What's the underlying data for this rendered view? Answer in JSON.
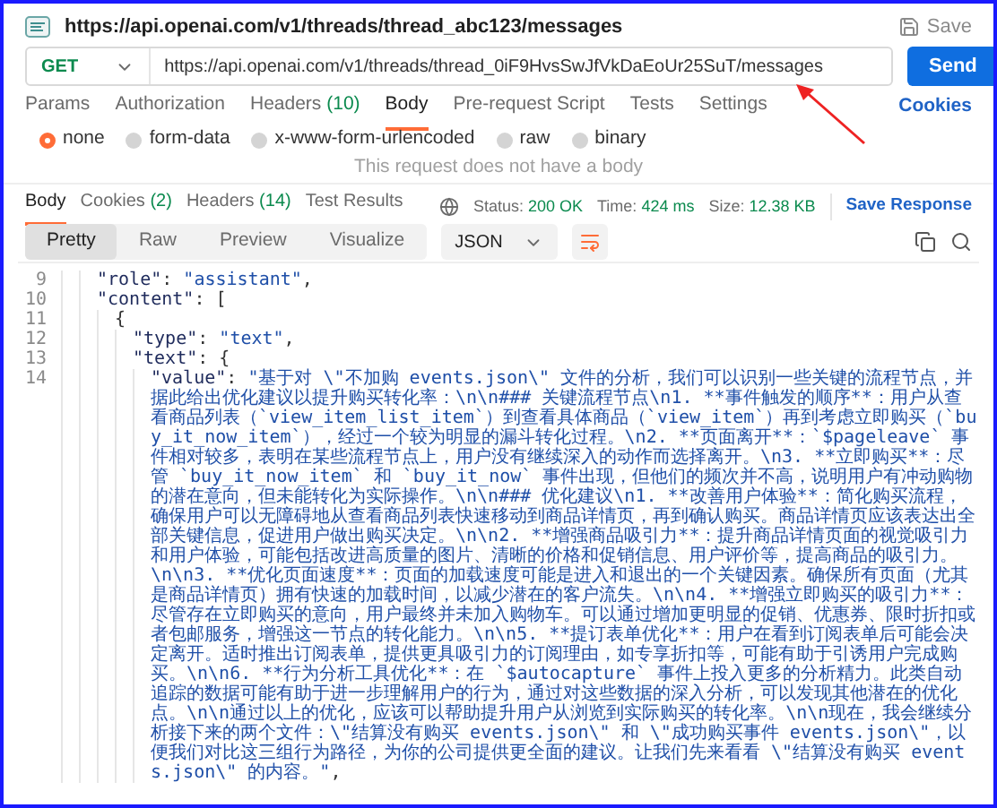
{
  "request": {
    "title": "https://api.openai.com/v1/threads/thread_abc123/messages",
    "save_label": "Save",
    "method": "GET",
    "url": "https://api.openai.com/v1/threads/thread_0iF9HvsSwJfVkDaEoUr25SuT/messages",
    "send_label": "Send"
  },
  "request_tabs": [
    {
      "label": "Params",
      "selected": false
    },
    {
      "label": "Authorization",
      "selected": false
    },
    {
      "label": "Headers",
      "count": "(10)",
      "selected": false
    },
    {
      "label": "Body",
      "selected": true
    },
    {
      "label": "Pre-request Script",
      "selected": false
    },
    {
      "label": "Tests",
      "selected": false
    },
    {
      "label": "Settings",
      "selected": false
    }
  ],
  "cookies_link": "Cookies",
  "body_types": [
    {
      "label": "none",
      "selected": true
    },
    {
      "label": "form-data",
      "selected": false
    },
    {
      "label": "x-www-form-urlencoded",
      "selected": false
    },
    {
      "label": "raw",
      "selected": false
    },
    {
      "label": "binary",
      "selected": false
    }
  ],
  "empty_body_message": "This request does not have a body",
  "response_tabs": [
    {
      "label": "Body",
      "selected": true
    },
    {
      "label": "Cookies",
      "count": "(2)",
      "selected": false
    },
    {
      "label": "Headers",
      "count": "(14)",
      "selected": false
    },
    {
      "label": "Test Results",
      "selected": false
    }
  ],
  "status": {
    "status_label": "Status:",
    "status_value": "200 OK",
    "time_label": "Time:",
    "time_value": "424 ms",
    "size_label": "Size:",
    "size_value": "12.38 KB"
  },
  "save_response": "Save Response",
  "view_modes": [
    {
      "label": "Pretty",
      "selected": true
    },
    {
      "label": "Raw",
      "selected": false
    },
    {
      "label": "Preview",
      "selected": false
    },
    {
      "label": "Visualize",
      "selected": false
    }
  ],
  "format": "JSON",
  "code_lines": [
    {
      "number": "9",
      "tokens": [
        {
          "kind": "key",
          "text": "\"role\""
        },
        {
          "kind": "punct",
          "text": ": "
        },
        {
          "kind": "string",
          "text": "\"assistant\""
        },
        {
          "kind": "punct",
          "text": ","
        }
      ]
    },
    {
      "number": "10",
      "tokens": [
        {
          "kind": "key",
          "text": "\"content\""
        },
        {
          "kind": "punct",
          "text": ": ["
        }
      ],
      "children": [
        {
          "number": "11",
          "tokens": [
            {
              "kind": "punct",
              "text": "{"
            }
          ],
          "children": [
            {
              "number": "12",
              "tokens": [
                {
                  "kind": "key",
                  "text": "\"type\""
                },
                {
                  "kind": "punct",
                  "text": ": "
                },
                {
                  "kind": "string",
                  "text": "\"text\""
                },
                {
                  "kind": "punct",
                  "text": ","
                }
              ]
            },
            {
              "number": "13",
              "tokens": [
                {
                  "kind": "key",
                  "text": "\"text\""
                },
                {
                  "kind": "punct",
                  "text": ": {"
                }
              ],
              "children": [
                {
                  "number": "14",
                  "tokens": [
                    {
                      "kind": "key",
                      "text": "\"value\""
                    },
                    {
                      "kind": "punct",
                      "text": ": "
                    },
                    {
                      "kind": "string",
                      "text": "\"基于对 \\\"不加购 events.json\\\" 文件的分析，我们可以识别一些关键的流程节点，并据此给出优化建议以提升购买转化率：\\n\\n### 关键流程节点\\n1. **事件触发的顺序**：用户从查看商品列表（`view_item_list_item`）到查看具体商品（`view_item`）再到考虑立即购买（`buy_it_now_item`），经过一个较为明显的漏斗转化过程。\\n2. **页面离开**：`$pageleave` 事件相对较多，表明在某些流程节点上，用户没有继续深入的动作而选择离开。\\n3. **立即购买**：尽管 `buy_it_now_item` 和 `buy_it_now` 事件出现，但他们的频次并不高，说明用户有冲动购物的潜在意向，但未能转化为实际操作。\\n\\n### 优化建议\\n1. **改善用户体验**：简化购买流程，确保用户可以无障碍地从查看商品列表快速移动到商品详情页，再到确认购买。商品详情页应该表达出全部关键信息，促进用户做出购买决定。\\n\\n2. **增强商品吸引力**：提升商品详情页面的视觉吸引力和用户体验，可能包括改进高质量的图片、清晰的价格和促销信息、用户评价等，提高商品的吸引力。\\n\\n3. **优化页面速度**：页面的加载速度可能是进入和退出的一个关键因素。确保所有页面（尤其是商品详情页）拥有快速的加载时间，以减少潜在的客户流失。\\n\\n4. **增强立即购买的吸引力**：尽管存在立即购买的意向，用户最终并未加入购物车。可以通过增加更明显的促销、优惠券、限时折扣或者包邮服务，增强这一节点的转化能力。\\n\\n5. **提订表单优化**：用户在看到订阅表单后可能会决定离开。适时推出订阅表单，提供更具吸引力的订阅理由，如专享折扣等，可能有助于引诱用户完成购买。\\n\\n6. **行为分析工具优化**：在 `$autocapture` 事件上投入更多的分析精力。此类自动追踪的数据可能有助于进一步理解用户的行为，通过对这些数据的深入分析，可以发现其他潜在的优化点。\\n\\n通过以上的优化，应该可以帮助提升用户从浏览到实际购买的转化率。\\n\\n现在，我会继续分析接下来的两个文件：\\\"结算没有购买 events.json\\\" 和 \\\"成功购买事件 events.json\\\"，以便我们对比这三组行为路径，为你的公司提供更全面的建议。让我们先来看看 \\\"结算没有购买 events.json\\\" 的内容。\""
                    },
                    {
                      "kind": "punct",
                      "text": ","
                    }
                  ]
                }
              ]
            }
          ]
        }
      ]
    }
  ]
}
